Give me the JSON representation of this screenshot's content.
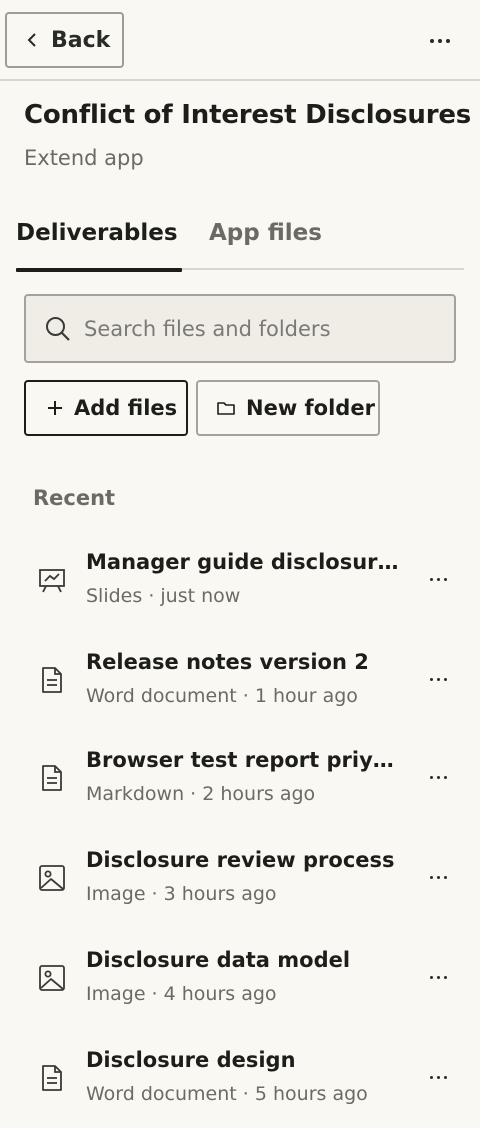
{
  "header": {
    "back_label": "Back"
  },
  "project": {
    "title": "Conflict of Interest Disclosures",
    "subtitle": "Extend app"
  },
  "tabs": [
    {
      "label": "Deliverables",
      "active": true
    },
    {
      "label": "App files",
      "active": false
    }
  ],
  "search": {
    "value": "",
    "placeholder": "Search files and folders"
  },
  "actions": {
    "add_files_label": "Add files",
    "new_folder_label": "New folder"
  },
  "recent": {
    "label": "Recent",
    "files": [
      {
        "name": "Manager guide disclosures",
        "type": "Slides",
        "time": "just now",
        "icon": "slides-icon"
      },
      {
        "name": "Release notes version 2",
        "type": "Word document",
        "time": "1 hour ago",
        "icon": "document-icon"
      },
      {
        "name": "Browser test report priya ...",
        "type": "Markdown",
        "time": "2 hours ago",
        "icon": "document-icon"
      },
      {
        "name": "Disclosure review process",
        "type": "Image",
        "time": "3 hours ago",
        "icon": "image-icon"
      },
      {
        "name": "Disclosure data model",
        "type": "Image",
        "time": "4 hours ago",
        "icon": "image-icon"
      },
      {
        "name": "Disclosure design",
        "type": "Word document",
        "time": "5 hours ago",
        "icon": "document-icon"
      }
    ]
  },
  "colors": {
    "background": "#f9f8f3",
    "text": "#1d1d1a",
    "muted": "#6b6a64",
    "border": "#a4a29b"
  }
}
